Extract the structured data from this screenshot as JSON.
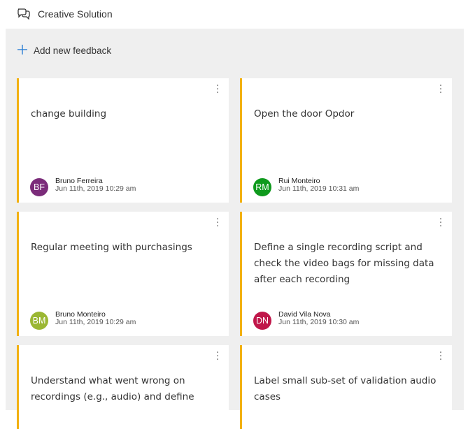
{
  "header": {
    "title": "Creative Solution",
    "icon": "chat-bubbles-icon"
  },
  "toolbar": {
    "add_label": "Add new feedback",
    "add_icon": "plus-icon",
    "accent": "#2b7fd4"
  },
  "cards": [
    {
      "text": "change building",
      "author": "Bruno Ferreira",
      "initials": "BF",
      "avatar_color": "#7b2c7a",
      "date": "Jun 11th, 2019 10:29 am"
    },
    {
      "text": "Open the door Opdor",
      "author": "Rui Monteiro",
      "initials": "RM",
      "avatar_color": "#0f9a1d",
      "date": "Jun 11th, 2019 10:31 am"
    },
    {
      "text": "Regular meeting with purchasings",
      "author": "Bruno Monteiro",
      "initials": "BM",
      "avatar_color": "#9bb733",
      "date": "Jun 11th, 2019 10:29 am"
    },
    {
      "text": "Define a single recording script and check the video bags for missing data after each recording",
      "author": "David Vila Nova",
      "initials": "DN",
      "avatar_color": "#c0174a",
      "date": "Jun 11th, 2019 10:30 am"
    },
    {
      "text": "Understand what went wrong on recordings (e.g., audio) and define",
      "author": "",
      "initials": "",
      "avatar_color": "",
      "date": ""
    },
    {
      "text": "Label small sub-set of validation audio cases",
      "author": "",
      "initials": "",
      "avatar_color": "",
      "date": ""
    }
  ],
  "card_accent": "#f2b112"
}
